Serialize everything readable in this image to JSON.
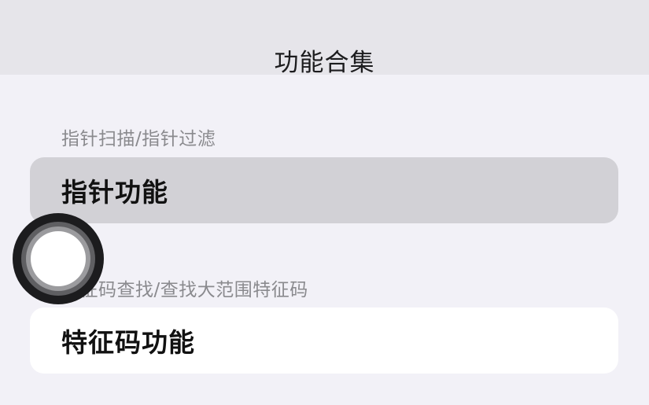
{
  "nav": {
    "title": "功能合集"
  },
  "sections": [
    {
      "header": "指针扫描/指针过滤",
      "cell_label": "指针功能"
    },
    {
      "header": "特征码查找/查找大范围特征码",
      "cell_label": "特征码功能"
    }
  ],
  "overlay": {
    "icon": "assistive-touch-icon"
  }
}
